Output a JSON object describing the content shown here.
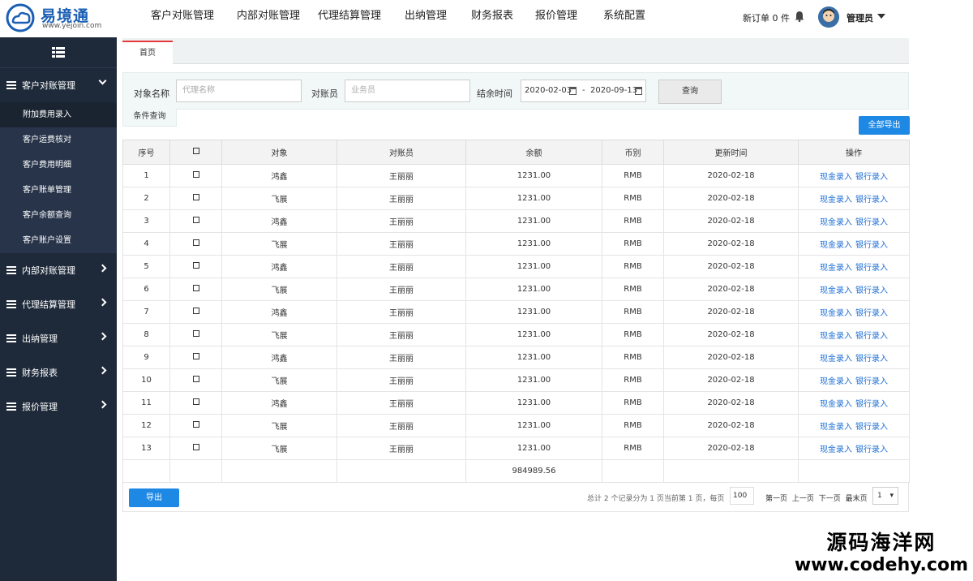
{
  "logo": {
    "name": "易境通",
    "url": "www.yejoin.com"
  },
  "topnav": [
    "客户对账管理",
    "内部对账管理",
    "代理结算管理",
    "出纳管理",
    "财务报表",
    "报价管理",
    "系统配置"
  ],
  "header": {
    "new_orders": "新订单 0 件",
    "user": "管理员"
  },
  "sidebar": {
    "groups": [
      {
        "label": "客户对账管理",
        "expanded": true,
        "items": [
          "附加费用录入",
          "客户运费核对",
          "客户费用明细",
          "客户账单管理",
          "客户余额查询",
          "客户账户设置"
        ]
      },
      {
        "label": "内部对账管理"
      },
      {
        "label": "代理结算管理"
      },
      {
        "label": "出纳管理"
      },
      {
        "label": "财务报表"
      },
      {
        "label": "报价管理"
      }
    ]
  },
  "tabs": {
    "home": "首页"
  },
  "filter": {
    "target_label": "对象名称",
    "target_placeholder": "代理名称",
    "clerk_label": "对账员",
    "clerk_placeholder": "业务员",
    "date_label": "结余时间",
    "date_from": "2020-02-03",
    "date_sep": "-",
    "date_to": "2020-09-13",
    "query_btn": "查询",
    "cond_tab": "条件查询",
    "export_all": "全部导出"
  },
  "table": {
    "headers": [
      "序号",
      "☐",
      "对象",
      "对账员",
      "余额",
      "币别",
      "更新时间",
      "操作"
    ],
    "rows": [
      [
        "1",
        "鸿鑫",
        "王丽丽",
        "1231.00",
        "RMB",
        "2020-02-18"
      ],
      [
        "2",
        "飞展",
        "王丽丽",
        "1231.00",
        "RMB",
        "2020-02-18"
      ],
      [
        "3",
        "鸿鑫",
        "王丽丽",
        "1231.00",
        "RMB",
        "2020-02-18"
      ],
      [
        "4",
        "飞展",
        "王丽丽",
        "1231.00",
        "RMB",
        "2020-02-18"
      ],
      [
        "5",
        "鸿鑫",
        "王丽丽",
        "1231.00",
        "RMB",
        "2020-02-18"
      ],
      [
        "6",
        "飞展",
        "王丽丽",
        "1231.00",
        "RMB",
        "2020-02-18"
      ],
      [
        "7",
        "鸿鑫",
        "王丽丽",
        "1231.00",
        "RMB",
        "2020-02-18"
      ],
      [
        "8",
        "飞展",
        "王丽丽",
        "1231.00",
        "RMB",
        "2020-02-18"
      ],
      [
        "9",
        "鸿鑫",
        "王丽丽",
        "1231.00",
        "RMB",
        "2020-02-18"
      ],
      [
        "10",
        "飞展",
        "王丽丽",
        "1231.00",
        "RMB",
        "2020-02-18"
      ],
      [
        "11",
        "鸿鑫",
        "王丽丽",
        "1231.00",
        "RMB",
        "2020-02-18"
      ],
      [
        "12",
        "飞展",
        "王丽丽",
        "1231.00",
        "RMB",
        "2020-02-18"
      ],
      [
        "13",
        "飞展",
        "王丽丽",
        "1231.00",
        "RMB",
        "2020-02-18"
      ]
    ],
    "actions": [
      "现金录入",
      "银行录入"
    ],
    "total": "984989.56"
  },
  "footer": {
    "export": "导出",
    "summary": "总计 2 个记录分为 1 页当前第 1 页，每页",
    "page_size": "100",
    "first": "第一页",
    "prev": "上一页",
    "next": "下一页",
    "last": "最末页",
    "page": "1"
  },
  "watermark": {
    "cn": "源码海洋网",
    "url": "www.codehy.com"
  },
  "colors": {
    "sidebar": "#1e2a3a",
    "primary_button": "#1e88e5",
    "link": "#1e6fd6",
    "active_tab": "#e4393c"
  }
}
